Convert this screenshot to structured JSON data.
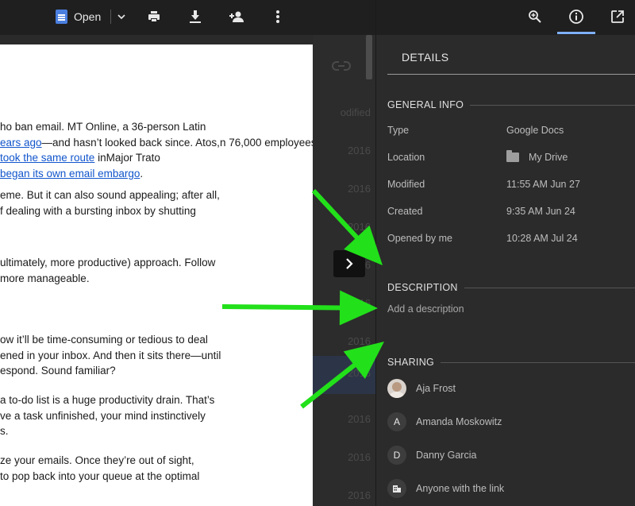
{
  "toolbar": {
    "open_label": "Open",
    "icons": [
      "doc-icon",
      "chevron-down-icon",
      "print-icon",
      "download-icon",
      "add-person-icon",
      "more-vert-icon"
    ]
  },
  "background_list": {
    "rows": [
      "odified",
      "2016",
      "2016",
      "2016",
      "2016",
      "2016",
      "2016",
      "2016",
      "2016",
      "2016",
      "2016"
    ]
  },
  "document": {
    "paragraphs": [
      [
        {
          "t": "ho ban email. MT Online, a 36-person Latin"
        },
        {
          "t": "ears ago",
          "link": true
        },
        {
          "t": "—and hasn’t looked back since. Atos,"
        },
        {
          "t": "n 76,000 employees, "
        },
        {
          "t": "took the same route",
          "link": true
        },
        {
          "t": " in"
        },
        {
          "t": "Major Trato "
        },
        {
          "t": "began its own email embargo",
          "link": true
        },
        {
          "t": "."
        }
      ],
      [
        {
          "t": "eme. But it can also sound appealing; after all,"
        },
        {
          "t": "f dealing with a bursting inbox by shutting"
        }
      ],
      [
        {
          "t": "ultimately, more productive) approach.  Follow"
        },
        {
          "t": "more manageable."
        }
      ],
      [
        {
          "t": "ow it’ll be time-consuming or tedious to deal"
        },
        {
          "t": "ened in your inbox. And then it sits there—until"
        },
        {
          "t": "espond. Sound familiar?"
        }
      ],
      [
        {
          "t": "a to-do list is a huge productivity drain. That’s"
        },
        {
          "t": "ve a task unfinished, your mind instinctively"
        },
        {
          "t": "s."
        }
      ],
      [
        {
          "t": "ze your emails. Once they’re out of sight,"
        },
        {
          "t": "to pop back into your queue at the optimal"
        }
      ]
    ]
  },
  "panel": {
    "tab_icons": [
      "zoom-in-icon",
      "info-icon",
      "open-in-new-icon"
    ],
    "title": "DETAILS",
    "general_info": {
      "heading": "GENERAL INFO",
      "rows": [
        {
          "label": "Type",
          "value": "Google Docs"
        },
        {
          "label": "Location",
          "value": "My Drive"
        },
        {
          "label": "Modified",
          "value": "11:55 AM Jun 27"
        },
        {
          "label": "Created",
          "value": "9:35 AM Jun 24"
        },
        {
          "label": "Opened by me",
          "value": "10:28 AM Jul 24"
        }
      ]
    },
    "description": {
      "heading": "DESCRIPTION",
      "placeholder": "Add a description"
    },
    "sharing": {
      "heading": "SHARING",
      "people": [
        {
          "initial": "",
          "name": "Aja Frost"
        },
        {
          "initial": "A",
          "name": "Amanda Moskowitz"
        },
        {
          "initial": "D",
          "name": "Danny Garcia"
        },
        {
          "initial": "",
          "name": "Anyone with the link"
        }
      ]
    }
  },
  "overlay": {
    "arrow_color": "#22e01a"
  }
}
